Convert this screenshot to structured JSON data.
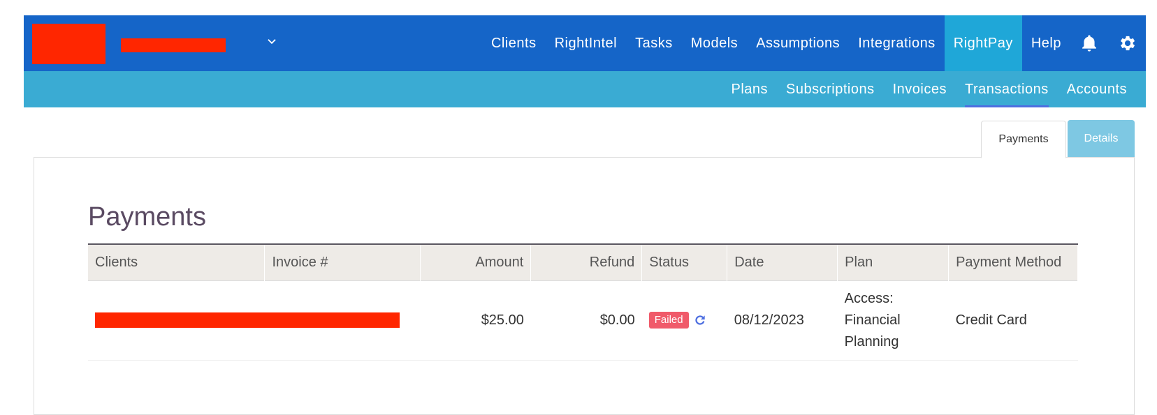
{
  "colors": {
    "navbar": "#1565c8",
    "navbar_active": "#1fa7d8",
    "subbar": "#3aabd3",
    "accent": "#4d6ee0",
    "failed_badge": "#f05a6a",
    "redaction": "#ff2600"
  },
  "header": {
    "org_dropdown_icon": "chevron-down-icon",
    "nav": [
      {
        "label": "Clients",
        "active": false
      },
      {
        "label": "RightIntel",
        "active": false
      },
      {
        "label": "Tasks",
        "active": false
      },
      {
        "label": "Models",
        "active": false
      },
      {
        "label": "Assumptions",
        "active": false
      },
      {
        "label": "Integrations",
        "active": false
      },
      {
        "label": "RightPay",
        "active": true
      },
      {
        "label": "Help",
        "active": false
      }
    ],
    "icons": [
      "bell-icon",
      "gear-icon"
    ]
  },
  "subnav": {
    "items": [
      {
        "label": "Plans",
        "active": false
      },
      {
        "label": "Subscriptions",
        "active": false
      },
      {
        "label": "Invoices",
        "active": false
      },
      {
        "label": "Transactions",
        "active": true
      },
      {
        "label": "Accounts",
        "active": false
      }
    ]
  },
  "tabs": [
    {
      "label": "Payments",
      "active": true
    },
    {
      "label": "Details",
      "active": false
    }
  ],
  "main": {
    "title": "Payments",
    "table": {
      "columns": [
        "Clients",
        "Invoice #",
        "Amount",
        "Refund",
        "Status",
        "Date",
        "Plan",
        "Payment Method"
      ],
      "rows": [
        {
          "client": "",
          "invoice": "",
          "amount": "$25.00",
          "refund": "$0.00",
          "status": "Failed",
          "status_icon": "retry-icon",
          "date": "08/12/2023",
          "plan_lines": [
            "Access:",
            "Financial",
            "Planning"
          ],
          "payment_method": "Credit Card"
        }
      ]
    }
  }
}
